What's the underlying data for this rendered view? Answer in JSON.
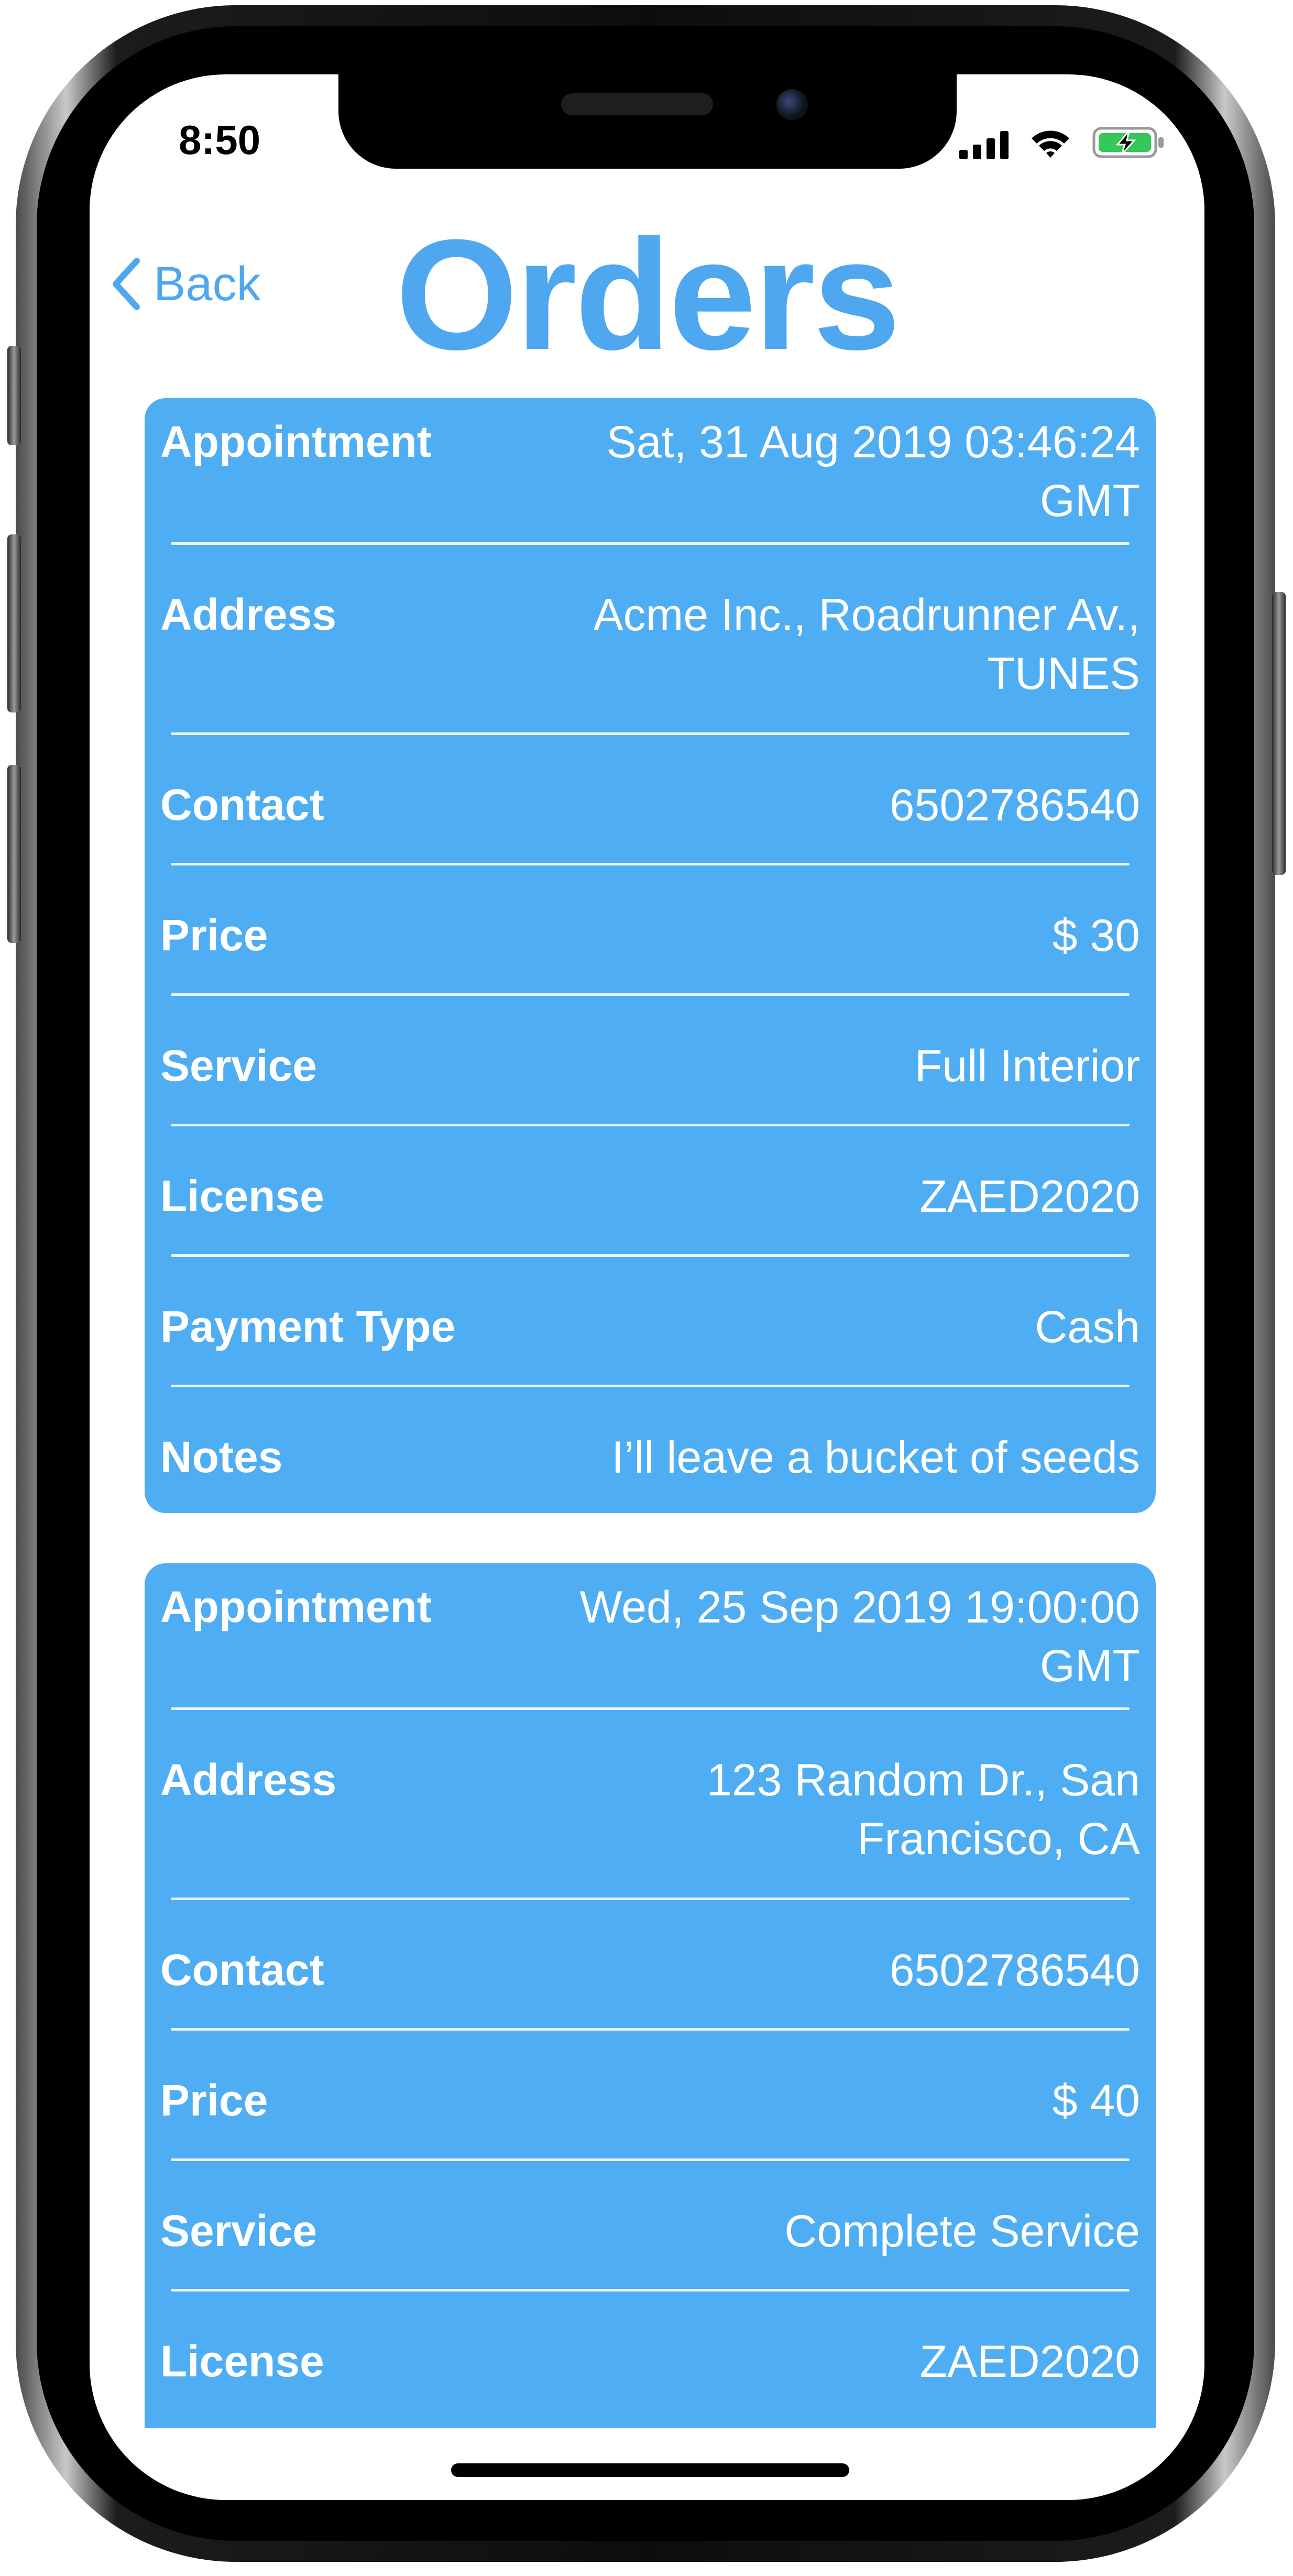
{
  "status_bar": {
    "time": "8:50"
  },
  "nav": {
    "back_label": "Back",
    "title": "Orders"
  },
  "colors": {
    "accent": "#4fa8ef",
    "card": "#4fadf3",
    "battery": "#34c759"
  },
  "orders": [
    {
      "fields": [
        {
          "label": "Appointment",
          "value": "Sat, 31 Aug 2019 03:46:24 GMT"
        },
        {
          "label": "Address",
          "value": "Acme Inc.,  Roadrunner Av., TUNES"
        },
        {
          "label": "Contact",
          "value": "6502786540"
        },
        {
          "label": "Price",
          "value": "$ 30"
        },
        {
          "label": "Service",
          "value": "Full Interior"
        },
        {
          "label": "License",
          "value": "ZAED2020"
        },
        {
          "label": "Payment Type",
          "value": "Cash"
        },
        {
          "label": "Notes",
          "value": "I’ll leave a bucket of seeds"
        }
      ]
    },
    {
      "fields": [
        {
          "label": "Appointment",
          "value": "Wed, 25 Sep 2019 19:00:00 GMT"
        },
        {
          "label": "Address",
          "value": "123 Random Dr., San Francisco, CA"
        },
        {
          "label": "Contact",
          "value": "6502786540"
        },
        {
          "label": "Price",
          "value": "$ 40"
        },
        {
          "label": "Service",
          "value": "Complete Service"
        },
        {
          "label": "License",
          "value": "ZAED2020"
        }
      ]
    }
  ]
}
